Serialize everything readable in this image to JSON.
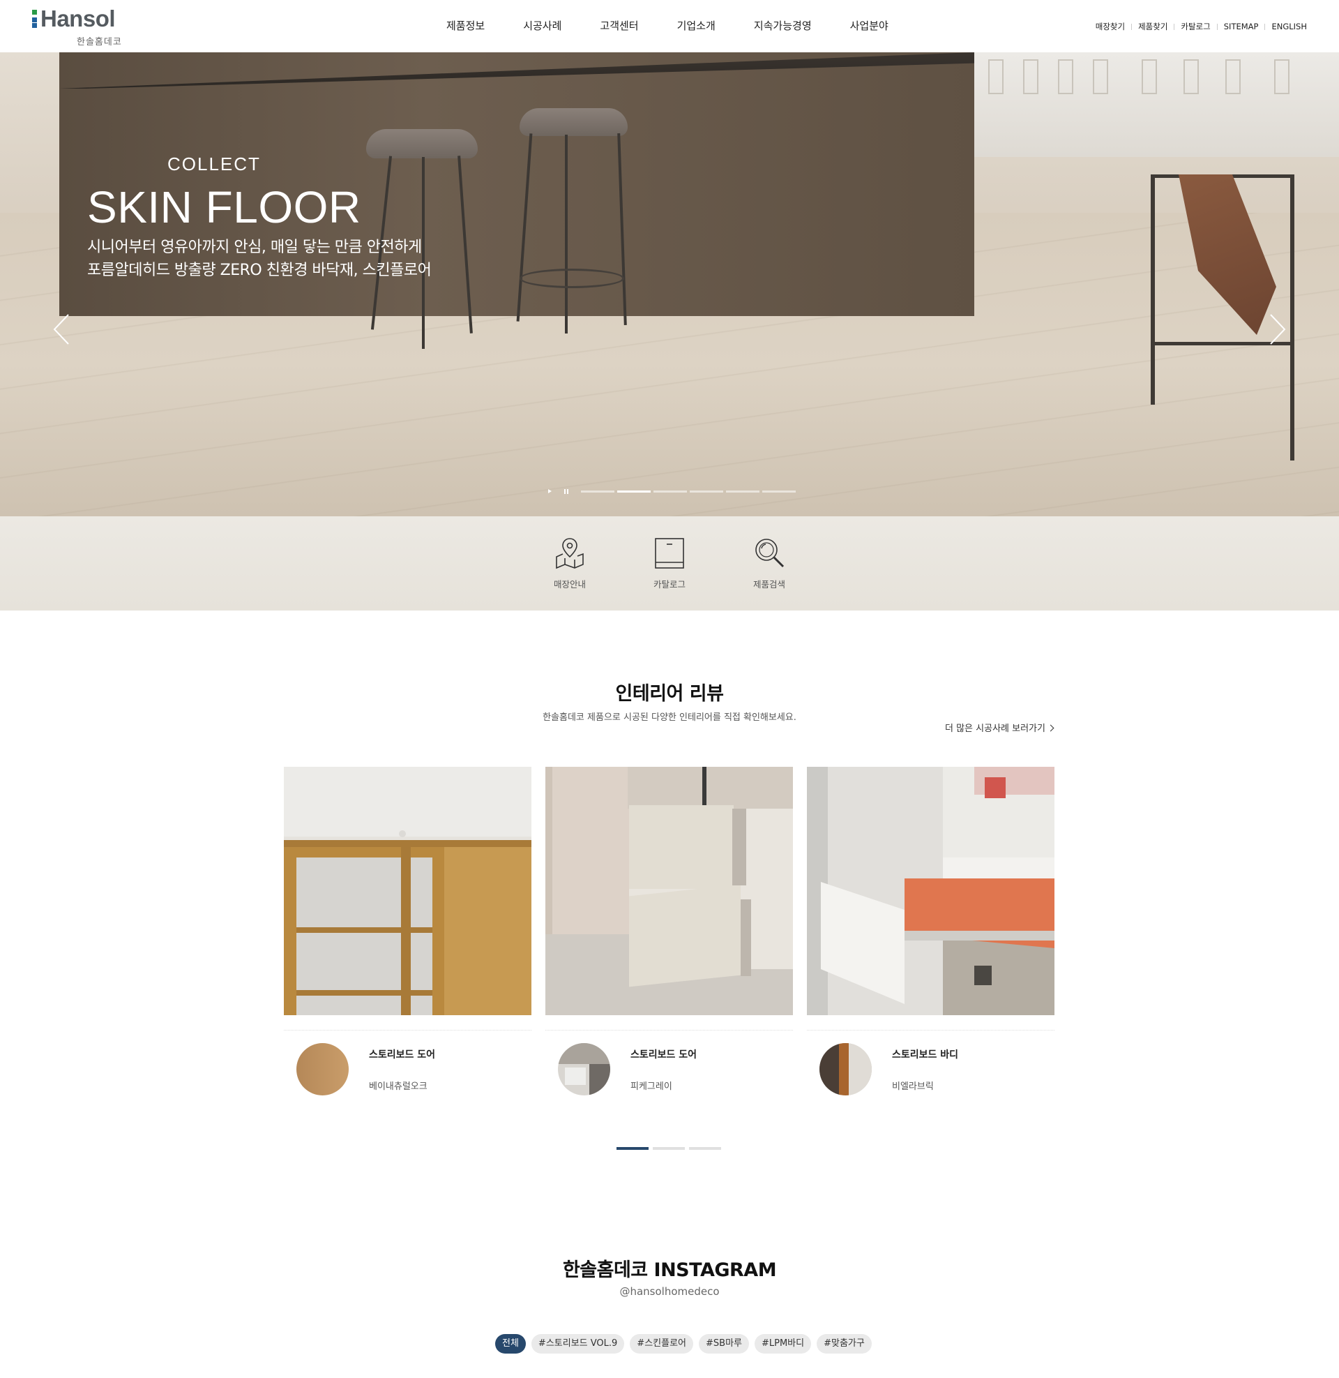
{
  "header": {
    "logo_word": "Hansol",
    "logo_sub": "한솔홈데코",
    "gnb": [
      "제품정보",
      "시공사례",
      "고객센터",
      "기업소개",
      "지속가능경영",
      "사업분야"
    ],
    "util": [
      "매장찾기",
      "제품찾기",
      "카탈로그",
      "SITEMAP",
      "ENGLISH"
    ]
  },
  "hero": {
    "eyebrow": "COLLECT",
    "title": "SKIN FLOOR",
    "desc_line1": "시니어부터 영유아까지 안심, 매일 닿는 만큼 안전하게",
    "desc_line2": "포름알데히드 방출량 ZERO 친환경 바닥재, 스킨플로어",
    "slide_count": 6,
    "active_slide": 2
  },
  "quick_links": [
    {
      "label": "매장안내",
      "icon": "map-pin-icon"
    },
    {
      "label": "카탈로그",
      "icon": "book-icon"
    },
    {
      "label": "제품검색",
      "icon": "search-icon"
    }
  ],
  "review": {
    "title": "인테리어 리뷰",
    "subtitle": "한솔홈데코 제품으로 시공된 다양한 인테리어를 직접 확인해보세요.",
    "more_link": "더 많은 시공사례 보러가기",
    "cards": [
      {
        "product": "스토리보드 도어",
        "color": "베이내츄럴오크"
      },
      {
        "product": "스토리보드 도어",
        "color": "피케그레이"
      },
      {
        "product": "스토리보드 바디",
        "color": "비엘라브릭"
      }
    ],
    "page_count": 3,
    "active_page": 1
  },
  "instagram": {
    "title": "한솔홈데코 INSTAGRAM",
    "handle": "@hansolhomedeco",
    "tags": [
      "전체",
      "#스토리보드 VOL.9",
      "#스킨플로어",
      "#SB마루",
      "#LPM바디",
      "#맞춤가구"
    ],
    "active_tag": "전체"
  },
  "colors": {
    "accent": "#27486c",
    "logo_green": "#2b9a48",
    "logo_blue": "#21619e"
  }
}
